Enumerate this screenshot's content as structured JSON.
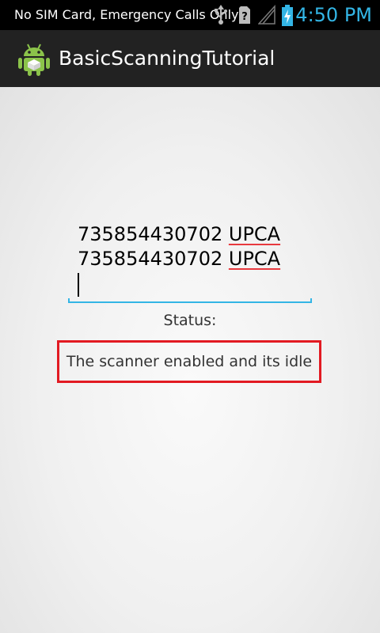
{
  "status_bar": {
    "carrier_text": "No SIM Card, Emergency Calls Only",
    "icons": [
      "usb-icon",
      "no-sim-icon",
      "signal-icon",
      "battery-charging-icon"
    ],
    "time": "4:50 PM",
    "time_color": "#33b5e5"
  },
  "action_bar": {
    "icon": "android-icon",
    "title": "BasicScanningTutorial"
  },
  "scan_field": {
    "lines": [
      {
        "code": "735854430702",
        "type": "UPCA"
      },
      {
        "code": "735854430702",
        "type": "UPCA"
      }
    ],
    "accent_color": "#33b5e5"
  },
  "status": {
    "label": "Status:",
    "message": "The scanner enabled and its idle",
    "highlight_color": "#e21a22"
  }
}
